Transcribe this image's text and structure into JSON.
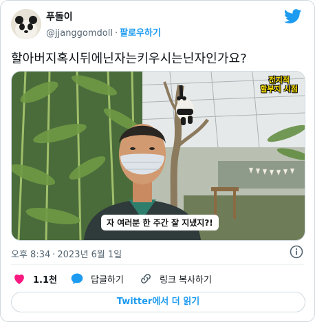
{
  "user": {
    "display_name": "푸돌이",
    "handle": "@jjanggomdoll",
    "separator": "·",
    "follow_label": "팔로우하기"
  },
  "tweet": {
    "text": "할아버지혹시뒤에닌자는키우시는닌자인가요?"
  },
  "media": {
    "corner_badge_line1": "전지적",
    "corner_badge_line2": "할부지 시점",
    "caption": "자 여러분 한 주간 잘 지냈지?!"
  },
  "meta": {
    "time": "오후 8:34",
    "separator": "·",
    "date": "2023년 6월 1일"
  },
  "actions": {
    "like_count": "1.1천",
    "reply_label": "답글하기",
    "copy_link_label": "링크 복사하기"
  },
  "footer": {
    "read_more_label": "Twitter에서 더 읽기"
  },
  "colors": {
    "brand_blue": "#1d9bf0",
    "like_red": "#f91880",
    "text_primary": "#0f1419",
    "text_secondary": "#536471",
    "border": "#cfd9de"
  },
  "icons": {
    "brand": "twitter-bird-icon",
    "info": "info-icon",
    "like": "heart-icon",
    "reply": "speech-bubble-icon",
    "copy_link": "link-icon"
  }
}
